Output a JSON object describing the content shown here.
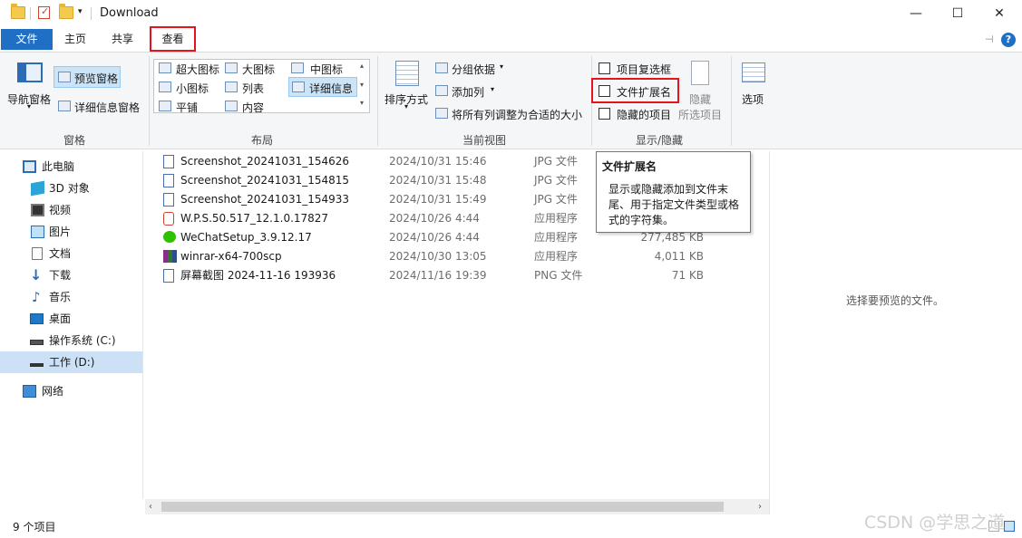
{
  "window": {
    "title": "Download",
    "minimize": "—",
    "maximize": "☐",
    "close": "✕"
  },
  "tabs": [
    "文件",
    "主页",
    "共享",
    "查看"
  ],
  "ribbon": {
    "panes": {
      "nav_pane": "导航窗格",
      "preview_pane": "预览窗格",
      "details_pane": "详细信息窗格",
      "group_label": "窗格"
    },
    "layout": {
      "items": [
        "超大图标",
        "大图标",
        "中图标",
        "小图标",
        "列表",
        "详细信息",
        "平铺",
        "内容"
      ],
      "group_label": "布局"
    },
    "current_view": {
      "sort": "排序方式",
      "group_by": "分组依据",
      "add_column": "添加列",
      "fit_columns": "将所有列调整为合适的大小",
      "group_label": "当前视图"
    },
    "show_hide": {
      "item_checkboxes": "项目复选框",
      "file_extensions": "文件扩展名",
      "hidden_items": "隐藏的项目",
      "hide_selected_1": "隐藏",
      "hide_selected_2": "所选项目",
      "group_label": "显示/隐藏"
    },
    "options": "选项"
  },
  "tooltip": {
    "title": "文件扩展名",
    "body": "显示或隐藏添加到文件末尾、用于指定文件类型或格式的字符集。"
  },
  "nav": [
    {
      "label": "此电脑",
      "icon": "computer-icon"
    },
    {
      "label": "3D 对象",
      "icon": "3d-objects-icon"
    },
    {
      "label": "视频",
      "icon": "video-icon"
    },
    {
      "label": "图片",
      "icon": "pictures-icon"
    },
    {
      "label": "文档",
      "icon": "documents-icon"
    },
    {
      "label": "下载",
      "icon": "download-icon"
    },
    {
      "label": "音乐",
      "icon": "music-icon"
    },
    {
      "label": "桌面",
      "icon": "desktop-icon"
    },
    {
      "label": "操作系统 (C:)",
      "icon": "drive-c-icon"
    },
    {
      "label": "工作 (D:)",
      "icon": "drive-d-icon"
    },
    {
      "label": "网络",
      "icon": "network-icon"
    }
  ],
  "files": [
    {
      "name": "Screenshot_20241031_154626",
      "date": "2024/10/31 15:46",
      "type": "JPG 文件",
      "size": ""
    },
    {
      "name": "Screenshot_20241031_154815",
      "date": "2024/10/31 15:48",
      "type": "JPG 文件",
      "size": ""
    },
    {
      "name": "Screenshot_20241031_154933",
      "date": "2024/10/31 15:49",
      "type": "JPG 文件",
      "size": ""
    },
    {
      "name": "W.P.S.50.517_12.1.0.17827",
      "date": "2024/10/26 4:44",
      "type": "应用程序",
      "size": ""
    },
    {
      "name": "WeChatSetup_3.9.12.17",
      "date": "2024/10/26 4:44",
      "type": "应用程序",
      "size": "277,485 KB"
    },
    {
      "name": "winrar-x64-700scp",
      "date": "2024/10/30 13:05",
      "type": "应用程序",
      "size": "4,011 KB"
    },
    {
      "name": "屏幕截图 2024-11-16 193936",
      "date": "2024/11/16 19:39",
      "type": "PNG 文件",
      "size": "71 KB"
    }
  ],
  "preview_message": "选择要预览的文件。",
  "status": "9 个项目",
  "watermark": "CSDN @学思之道",
  "colors": {
    "accent": "#1f6fc5",
    "highlight_box": "#e5141b",
    "selected": "#cce1f5"
  }
}
